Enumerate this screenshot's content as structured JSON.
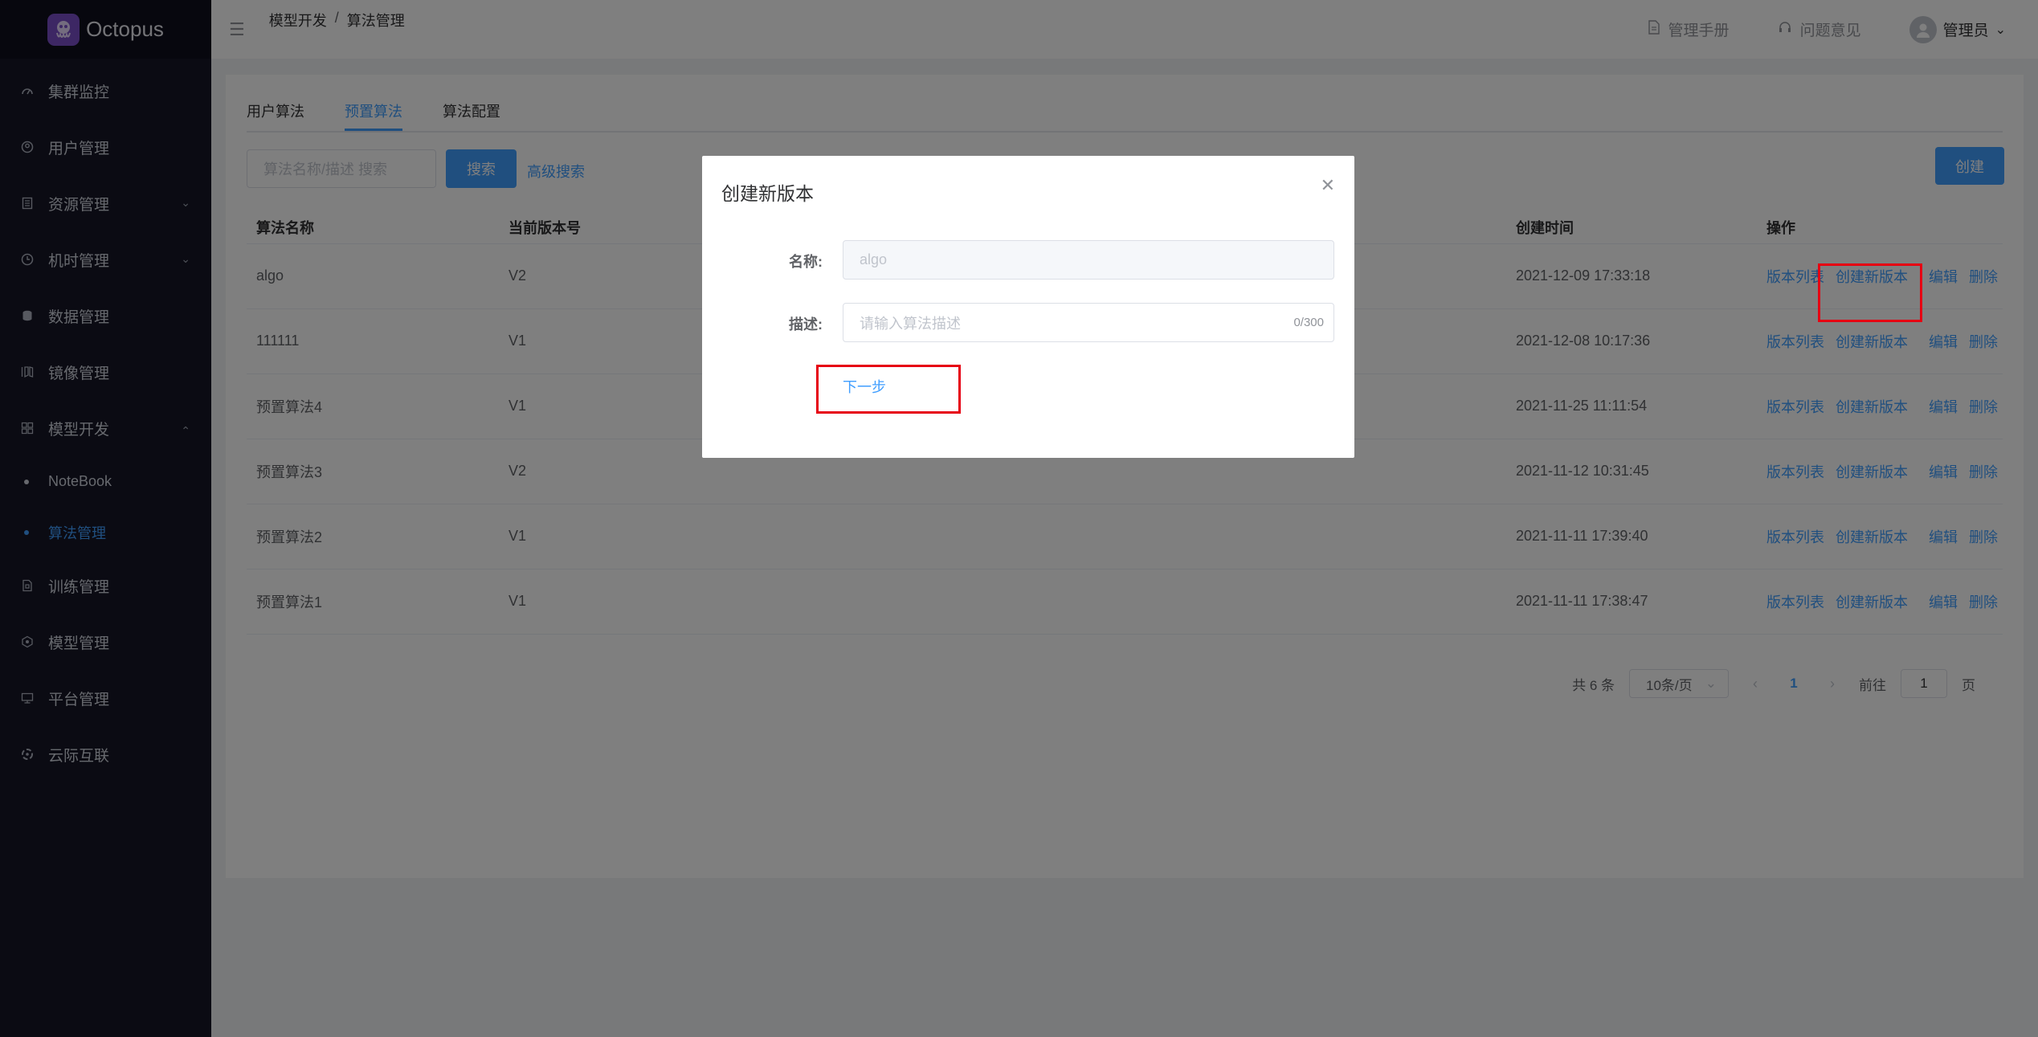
{
  "app": {
    "name": "Octopus"
  },
  "sidebar": {
    "items": [
      {
        "label": "集群监控",
        "icon": "cluster-monitor-icon"
      },
      {
        "label": "用户管理",
        "icon": "user-icon"
      },
      {
        "label": "资源管理",
        "icon": "resource-icon",
        "expandable": true
      },
      {
        "label": "机时管理",
        "icon": "clock-icon",
        "expandable": true
      },
      {
        "label": "数据管理",
        "icon": "database-icon"
      },
      {
        "label": "镜像管理",
        "icon": "image-icon"
      },
      {
        "label": "模型开发",
        "icon": "grid-icon",
        "expanded": true
      }
    ],
    "sub_items": [
      {
        "label": "NoteBook"
      },
      {
        "label": "算法管理",
        "active": true
      }
    ],
    "items_after": [
      {
        "label": "训练管理",
        "icon": "training-icon"
      },
      {
        "label": "模型管理",
        "icon": "model-icon"
      },
      {
        "label": "平台管理",
        "icon": "platform-icon"
      },
      {
        "label": "云际互联",
        "icon": "cloud-link-icon"
      }
    ]
  },
  "header": {
    "breadcrumb": [
      "模型开发",
      "/",
      "算法管理"
    ],
    "manual": "管理手册",
    "feedback": "问题意见",
    "user": "管理员"
  },
  "tabs": [
    "用户算法",
    "预置算法",
    "算法配置"
  ],
  "active_tab": 1,
  "toolbar": {
    "search_placeholder": "算法名称/描述 搜索",
    "search_btn": "搜索",
    "advanced": "高级搜索",
    "create_btn": "创建"
  },
  "table": {
    "headers": [
      "算法名称",
      "当前版本号",
      "创建时间",
      "操作"
    ],
    "rows": [
      {
        "name": "algo",
        "version": "V2",
        "created": "2021-12-09 17:33:18"
      },
      {
        "name": "111111",
        "version": "V1",
        "created": "2021-12-08 10:17:36"
      },
      {
        "name": "预置算法4",
        "version": "V1",
        "created": "2021-11-25 11:11:54"
      },
      {
        "name": "预置算法3",
        "version": "V2",
        "created": "2021-11-12 10:31:45"
      },
      {
        "name": "预置算法2",
        "version": "V1",
        "created": "2021-11-11 17:39:40"
      },
      {
        "name": "预置算法1",
        "version": "V1",
        "created": "2021-11-11 17:38:47"
      }
    ],
    "ops": [
      "版本列表",
      "创建新版本",
      "编辑",
      "删除"
    ]
  },
  "pagination": {
    "total": "共 6 条",
    "page_size": "10条/页",
    "current": "1",
    "goto_prefix": "前往",
    "goto_value": "1",
    "goto_suffix": "页"
  },
  "dialog": {
    "title": "创建新版本",
    "name_label": "名称:",
    "name_value": "algo",
    "desc_label": "描述:",
    "desc_placeholder": "请输入算法描述",
    "desc_counter": "0/300",
    "next_btn": "下一步"
  },
  "colors": {
    "sidebar_bg": "#161626",
    "primary": "#409eff",
    "highlight": "#e60012",
    "logo": "#7b4fc8"
  }
}
